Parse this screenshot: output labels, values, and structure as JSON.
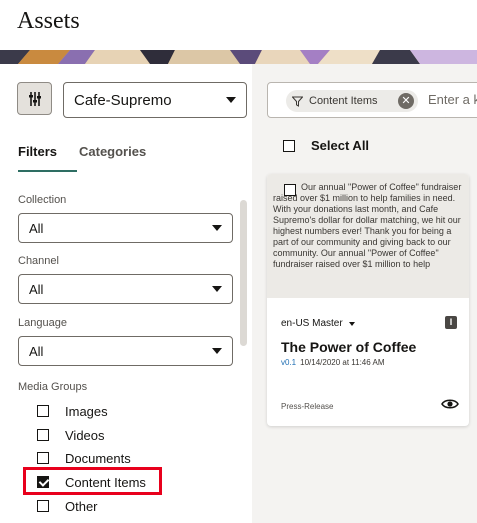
{
  "page": {
    "title": "Assets"
  },
  "toolbar": {
    "repository": "Cafe-Supremo",
    "search": {
      "chip_label": "Content Items",
      "placeholder": "Enter a k"
    }
  },
  "filters": {
    "tabs": [
      {
        "label": "Filters",
        "active": true
      },
      {
        "label": "Categories",
        "active": false
      }
    ],
    "collection": {
      "label": "Collection",
      "value": "All"
    },
    "channel": {
      "label": "Channel",
      "value": "All"
    },
    "language": {
      "label": "Language",
      "value": "All"
    },
    "media_groups": {
      "label": "Media Groups",
      "items": [
        {
          "label": "Images",
          "checked": false
        },
        {
          "label": "Videos",
          "checked": false
        },
        {
          "label": "Documents",
          "checked": false
        },
        {
          "label": "Content Items",
          "checked": true
        },
        {
          "label": "Other",
          "checked": false
        }
      ]
    }
  },
  "results": {
    "select_all_label": "Select All",
    "cards": [
      {
        "preview_text": "Our annual \"Power of Coffee\" fundraiser raised over $1 million to help families in need. With your donations last month, and Cafe Supremo's dollar for dollar matching, we hit our highest numbers ever! Thank you for being a part of our community and giving back to our community. Our annual \"Power of Coffee\" fundraiser raised over $1 million to help",
        "language": "en-US Master",
        "badge": "I",
        "title": "The Power of Coffee",
        "version": "v0.1",
        "date": "10/14/2020 at 11:46 AM",
        "type": "Press-Release"
      }
    ]
  },
  "colors": {
    "accent": "#2e6e63",
    "highlight": "#e8001c",
    "version_link": "#1f6eb3",
    "background": "#f4f3f1"
  },
  "icons": {
    "filter_toggle": "sliders-icon",
    "search_filter": "funnel-icon",
    "preview": "eye-icon"
  }
}
